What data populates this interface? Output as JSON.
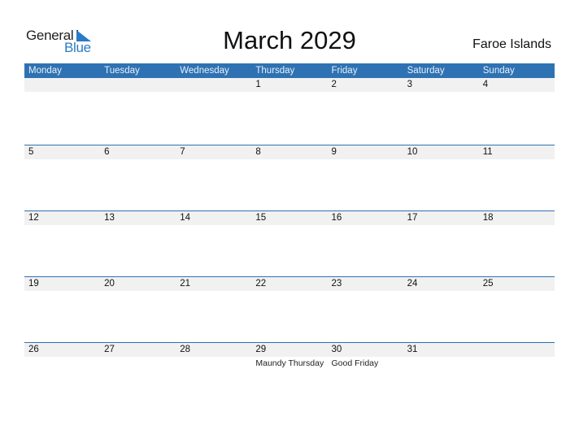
{
  "logo": {
    "general": "General",
    "blue": "Blue"
  },
  "title": "March 2029",
  "country": "Faroe Islands",
  "weekdays": [
    "Monday",
    "Tuesday",
    "Wednesday",
    "Thursday",
    "Friday",
    "Saturday",
    "Sunday"
  ],
  "weeks": [
    {
      "days": [
        "",
        "",
        "",
        "1",
        "2",
        "3",
        "4"
      ],
      "notes": [
        "",
        "",
        "",
        "",
        "",
        "",
        ""
      ]
    },
    {
      "days": [
        "5",
        "6",
        "7",
        "8",
        "9",
        "10",
        "11"
      ],
      "notes": [
        "",
        "",
        "",
        "",
        "",
        "",
        ""
      ]
    },
    {
      "days": [
        "12",
        "13",
        "14",
        "15",
        "16",
        "17",
        "18"
      ],
      "notes": [
        "",
        "",
        "",
        "",
        "",
        "",
        ""
      ]
    },
    {
      "days": [
        "19",
        "20",
        "21",
        "22",
        "23",
        "24",
        "25"
      ],
      "notes": [
        "",
        "",
        "",
        "",
        "",
        "",
        ""
      ]
    },
    {
      "days": [
        "26",
        "27",
        "28",
        "29",
        "30",
        "31",
        ""
      ],
      "notes": [
        "",
        "",
        "",
        "Maundy Thursday",
        "Good Friday",
        "",
        ""
      ]
    }
  ],
  "colors": {
    "accent": "#2e72b3",
    "day_band": "#f1f1f1"
  }
}
